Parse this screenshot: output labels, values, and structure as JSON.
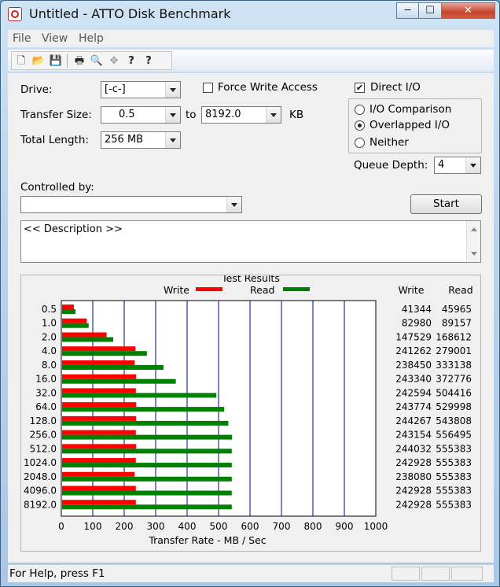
{
  "window": {
    "title": "Untitled - ATTO Disk Benchmark",
    "minimize": "─",
    "maximize": "☐",
    "close": "✕"
  },
  "menu": {
    "items": [
      "File",
      "View",
      "Help"
    ]
  },
  "toolbar": {
    "new": "🗋",
    "open": "📂",
    "save": "💾",
    "print": "🖶",
    "preview": "🔍",
    "move": "✥",
    "help": "?",
    "context_help": "?"
  },
  "form": {
    "drive_label": "Drive:",
    "drive_value": "[-c-]",
    "force_write_label": "Force Write Access",
    "force_write_checked": false,
    "direct_io_label": "Direct I/O",
    "direct_io_checked": true,
    "transfer_size_label": "Transfer Size:",
    "transfer_from": "0.5",
    "to_label": "to",
    "transfer_to": "8192.0",
    "kb_label": "KB",
    "total_length_label": "Total Length:",
    "total_length_value": "256 MB",
    "radio_io_comparison": "I/O Comparison",
    "radio_overlapped": "Overlapped I/O",
    "radio_neither": "Neither",
    "selected_mode": "Overlapped I/O",
    "queue_depth_label": "Queue Depth:",
    "queue_depth_value": "4",
    "controlled_by_label": "Controlled by:",
    "controlled_by_value": "",
    "start_label": "Start",
    "description": "<< Description >>"
  },
  "chart_data": {
    "type": "bar",
    "title": "Test Results",
    "xlabel": "Transfer Rate - MB / Sec",
    "xlim": [
      0,
      1000
    ],
    "xticks": [
      0,
      100,
      200,
      300,
      400,
      500,
      600,
      700,
      800,
      900,
      1000
    ],
    "categories": [
      "0.5",
      "1.0",
      "2.0",
      "4.0",
      "8.0",
      "16.0",
      "32.0",
      "64.0",
      "128.0",
      "256.0",
      "512.0",
      "1024.0",
      "2048.0",
      "4096.0",
      "8192.0"
    ],
    "series": [
      {
        "name": "Write",
        "color": "#ff0000",
        "values": [
          40,
          81,
          144,
          236,
          233,
          238,
          237,
          238,
          238,
          237,
          238,
          237,
          233,
          237,
          237
        ],
        "table": [
          "41344",
          "82980",
          "147529",
          "241262",
          "238450",
          "243340",
          "242594",
          "243774",
          "244267",
          "243154",
          "244032",
          "242928",
          "238080",
          "242928",
          "242928"
        ]
      },
      {
        "name": "Read",
        "color": "#008000",
        "values": [
          45,
          87,
          165,
          272,
          325,
          364,
          493,
          518,
          531,
          543,
          542,
          542,
          542,
          542,
          542
        ],
        "table": [
          "45965",
          "89157",
          "168612",
          "279001",
          "333138",
          "372776",
          "504416",
          "529998",
          "543808",
          "556495",
          "555383",
          "555383",
          "555383",
          "555383",
          "555383"
        ]
      }
    ],
    "col_write": "Write",
    "col_read": "Read"
  },
  "status": {
    "text": "For Help, press F1"
  }
}
